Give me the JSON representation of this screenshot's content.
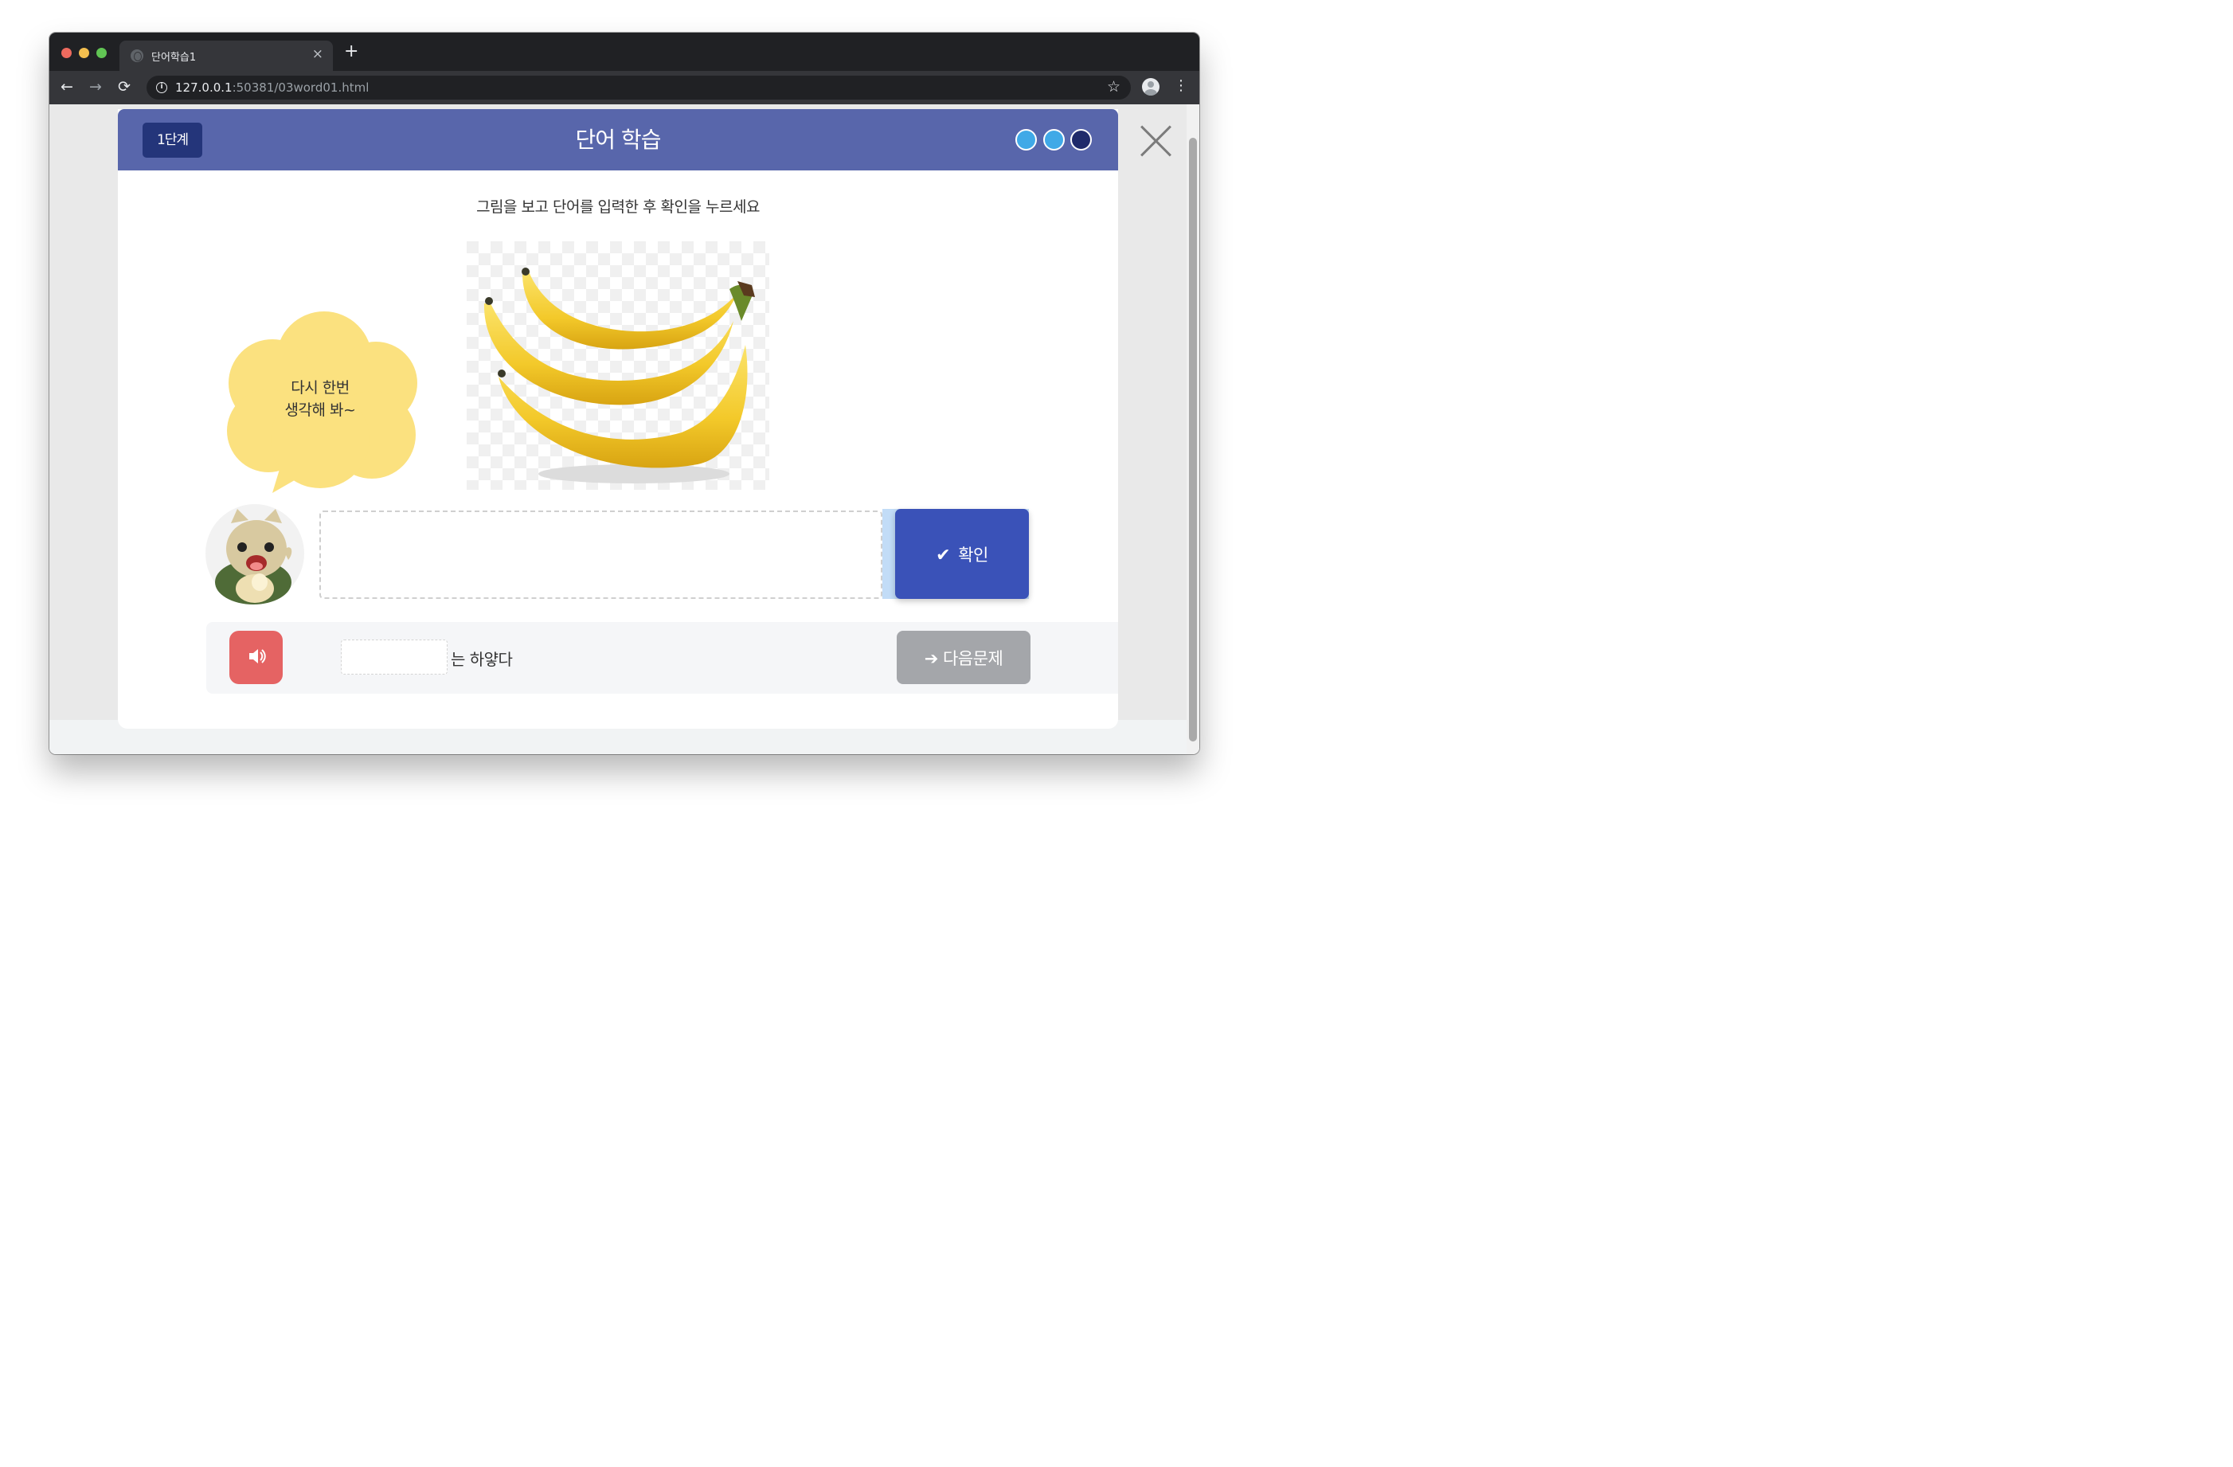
{
  "browser": {
    "tab_title": "단어학습1",
    "tab_close": "×",
    "new_tab": "+",
    "url_host": "127.0.0.1",
    "url_rest": ":50381/03word01.html",
    "nav": {
      "back": "←",
      "forward": "→",
      "reload": "⟳"
    },
    "star": "☆",
    "menu": "⋮"
  },
  "header": {
    "step_label": "1단계",
    "title": "단어 학습",
    "progress": {
      "total": 3,
      "completed": 2
    },
    "colors": {
      "bar": "#5866ab",
      "badge": "#24357a",
      "dot_done": "#40a9e7",
      "dot_current": "#1f2a6b"
    }
  },
  "lesson": {
    "instruction": "그림을 보고 단어를 입력한 후 확인을 누르세요",
    "picture": "banana-image",
    "hint_line1": "다시 한번",
    "hint_line2": "생각해 봐~",
    "answer_value": "",
    "confirm_label": "확인",
    "confirm_check": "✔"
  },
  "sentence": {
    "blank_value": "",
    "suffix": "는 하얗다",
    "next_label": "다음문제",
    "next_arrow": "➔"
  }
}
